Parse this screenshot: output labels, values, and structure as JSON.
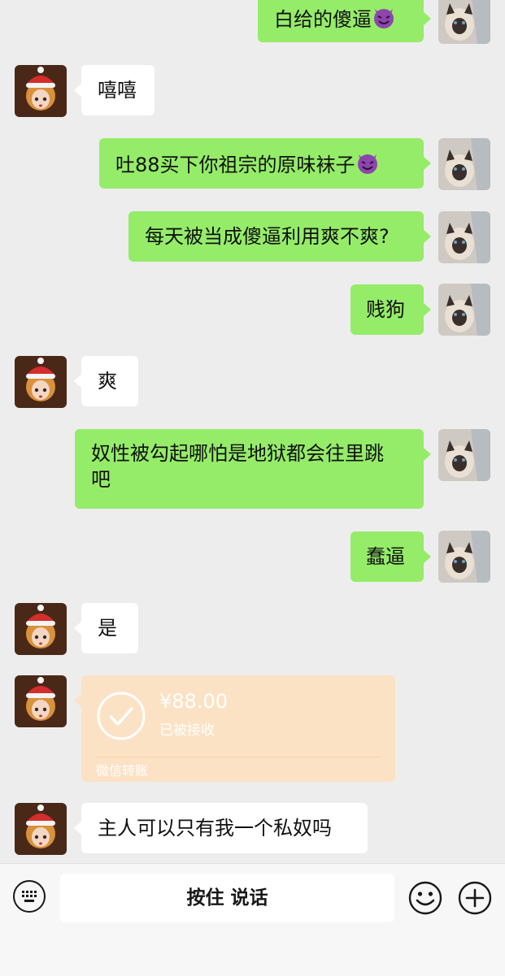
{
  "messages": {
    "m1": "白给的傻逼",
    "m2": "嘻嘻",
    "m3": "吐88买下你祖宗的原味袜子",
    "m4": "每天被当成傻逼利用爽不爽?",
    "m5": "贱狗",
    "m6": "爽",
    "m7_line1": "奴性被勾起哪怕是地狱都会往里跳",
    "m7_line2": "吧",
    "m8": "蠢逼",
    "m9": "是",
    "m10": "主人可以只有我一个私奴吗"
  },
  "transfer": {
    "amount": "¥88.00",
    "status": "已被接收",
    "footer": "微信转账"
  },
  "input_bar": {
    "hold_to_talk": "按住 说话"
  },
  "colors": {
    "outgoing_bubble": "#95ec69",
    "incoming_bubble": "#ffffff",
    "transfer_card": "#fce2c4",
    "background": "#ededed"
  }
}
